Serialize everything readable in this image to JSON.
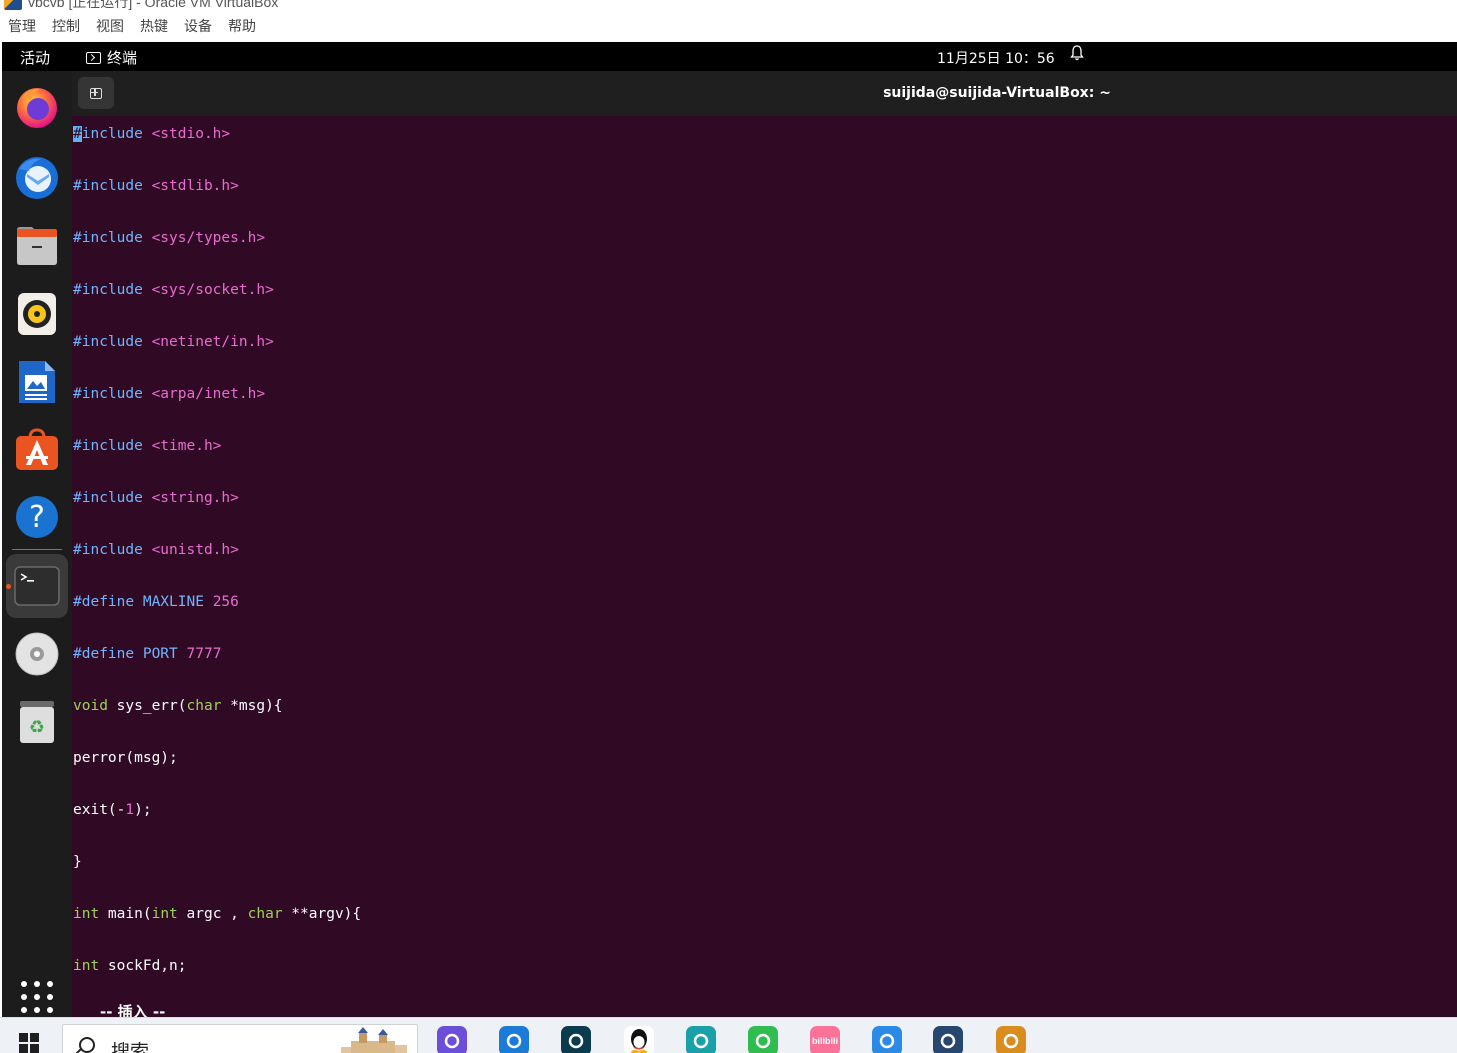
{
  "window": {
    "title": "vbcvb [正在运行] - Oracle VM VirtualBox",
    "menu": [
      "管理",
      "控制",
      "视图",
      "热键",
      "设备",
      "帮助"
    ]
  },
  "topbar": {
    "activities": "活动",
    "app_name": "终端",
    "clock": "11月25日  10：56"
  },
  "terminal": {
    "title": "suijida@suijida-VirtualBox: ~",
    "mode": "-- 插入 --",
    "lines": [
      [
        [
          "cursor",
          "#"
        ],
        [
          "pp",
          "include "
        ],
        [
          "inc",
          "<stdio.h>"
        ]
      ],
      [
        [
          "pp",
          "#include "
        ],
        [
          "inc",
          "<stdlib.h>"
        ]
      ],
      [
        [
          "pp",
          "#include "
        ],
        [
          "inc",
          "<sys/types.h>"
        ]
      ],
      [
        [
          "pp",
          "#include "
        ],
        [
          "inc",
          "<sys/socket.h>"
        ]
      ],
      [
        [
          "pp",
          "#include "
        ],
        [
          "inc",
          "<netinet/in.h>"
        ]
      ],
      [
        [
          "pp",
          "#include "
        ],
        [
          "inc",
          "<arpa/inet.h>"
        ]
      ],
      [
        [
          "pp",
          "#include "
        ],
        [
          "inc",
          "<time.h>"
        ]
      ],
      [
        [
          "pp",
          "#include "
        ],
        [
          "inc",
          "<string.h>"
        ]
      ],
      [
        [
          "pp",
          "#include "
        ],
        [
          "inc",
          "<unistd.h>"
        ]
      ],
      [
        [
          "pp",
          "#define MAXLINE "
        ],
        [
          "num",
          "256"
        ]
      ],
      [
        [
          "pp",
          "#define PORT "
        ],
        [
          "num",
          "7777"
        ]
      ],
      [
        [
          "kw",
          "void"
        ],
        [
          "plain",
          " sys_err("
        ],
        [
          "kw",
          "char"
        ],
        [
          "plain",
          " *msg){"
        ]
      ],
      [
        [
          "plain",
          "perror(msg);"
        ]
      ],
      [
        [
          "plain",
          "exit(-"
        ],
        [
          "num",
          "1"
        ],
        [
          "plain",
          ");"
        ]
      ],
      [
        [
          "plain",
          "}"
        ]
      ],
      [
        [
          "kw",
          "int"
        ],
        [
          "plain",
          " main("
        ],
        [
          "kw",
          "int"
        ],
        [
          "plain",
          " argc , "
        ],
        [
          "kw",
          "char"
        ],
        [
          "plain",
          " **argv){"
        ]
      ],
      [
        [
          "kw",
          "int"
        ],
        [
          "plain",
          " sockFd,n;"
        ]
      ]
    ]
  },
  "dock": [
    {
      "name": "firefox-icon"
    },
    {
      "name": "thunderbird-icon"
    },
    {
      "name": "files-icon"
    },
    {
      "name": "rhythmbox-icon"
    },
    {
      "name": "libreoffice-writer-icon"
    },
    {
      "name": "ubuntu-software-icon"
    },
    {
      "name": "help-icon"
    },
    {
      "name": "terminal-icon"
    },
    {
      "name": "dvd-icon"
    },
    {
      "name": "trash-icon"
    }
  ],
  "taskbar": {
    "search_label": "搜索",
    "bilibili_label": "bilibili",
    "apps": [
      {
        "name": "app-purple-icon",
        "color": "#6b4fd8"
      },
      {
        "name": "ie-icon",
        "color": "#1b7cd8"
      },
      {
        "name": "app-ring-icon",
        "color": "#0b3b4f"
      },
      {
        "name": "qq-icon",
        "color": "#ffffff"
      },
      {
        "name": "edge-icon",
        "color": "#1aa0a8"
      },
      {
        "name": "player-icon",
        "color": "#2fbd4f"
      },
      {
        "name": "bilibili-icon",
        "color": "#fb7299"
      },
      {
        "name": "app-circle-icon",
        "color": "#2a8ae6"
      },
      {
        "name": "virtualbox-icon",
        "color": "#27476e"
      },
      {
        "name": "app-64-icon",
        "color": "#d98d1f"
      }
    ]
  }
}
